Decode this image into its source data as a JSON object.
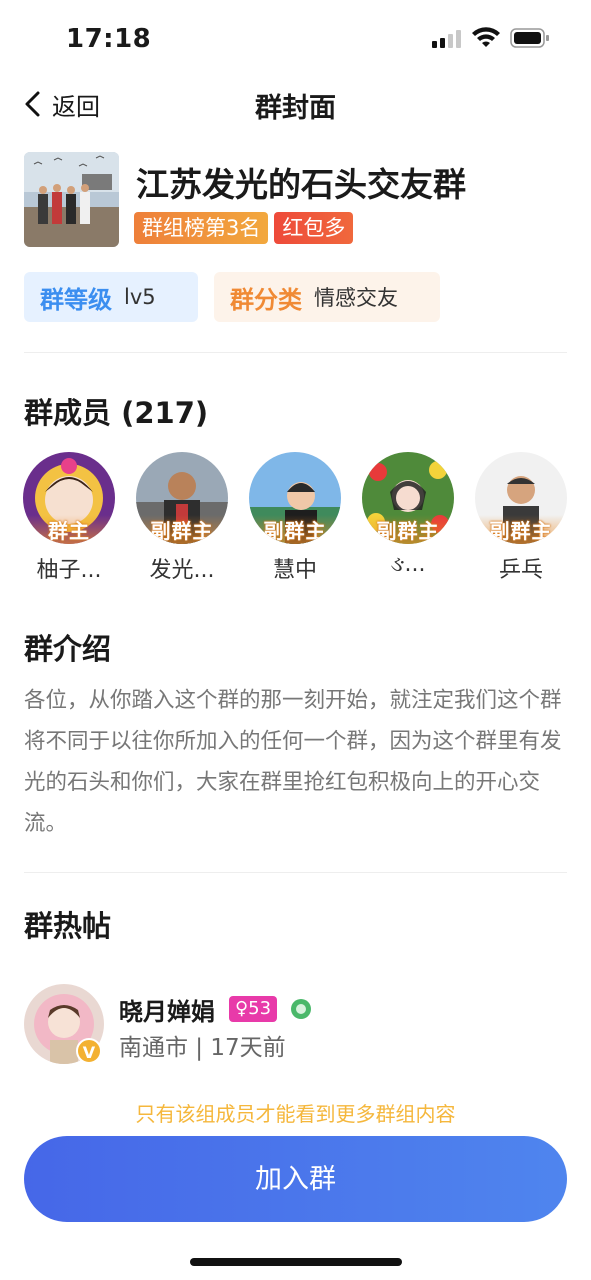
{
  "status_bar": {
    "time": "17:18"
  },
  "nav": {
    "back_label": "返回",
    "title": "群封面"
  },
  "group": {
    "name": "江苏发光的石头交友群",
    "tags": [
      "群组榜第3名",
      "红包多"
    ],
    "level_label": "群等级",
    "level_value": "lv5",
    "category_label": "群分类",
    "category_value": "情感交友"
  },
  "members_section": {
    "title": "群成员 (217)",
    "members": [
      {
        "role": "群主",
        "name": "柚子..."
      },
      {
        "role": "副群主",
        "name": "发光..."
      },
      {
        "role": "副群主",
        "name": "慧中"
      },
      {
        "role": "副群主",
        "name": "ઙ..."
      },
      {
        "role": "副群主",
        "name": "乒乓"
      }
    ]
  },
  "intro_section": {
    "title": "群介绍",
    "text": "各位，从你踏入这个群的那一刻开始，就注定我们这个群将不同于以往你所加入的任何一个群，因为这个群里有发光的石头和你们，大家在群里抢红包积极向上的开心交流。"
  },
  "hot_posts_section": {
    "title": "群热帖",
    "post": {
      "author": "晓月婵娟",
      "gender_age": "♀53",
      "location_time": "南通市 | 17天前",
      "avatar_badge": "V"
    }
  },
  "members_only_note": "只有该组成员才能看到更多群组内容",
  "join_button_label": "加入群",
  "colors": {
    "primary": "#4a72ea",
    "orange_tag": "#ee7f3a",
    "red_tag": "#ee4a3a",
    "note": "#f5b73c"
  }
}
